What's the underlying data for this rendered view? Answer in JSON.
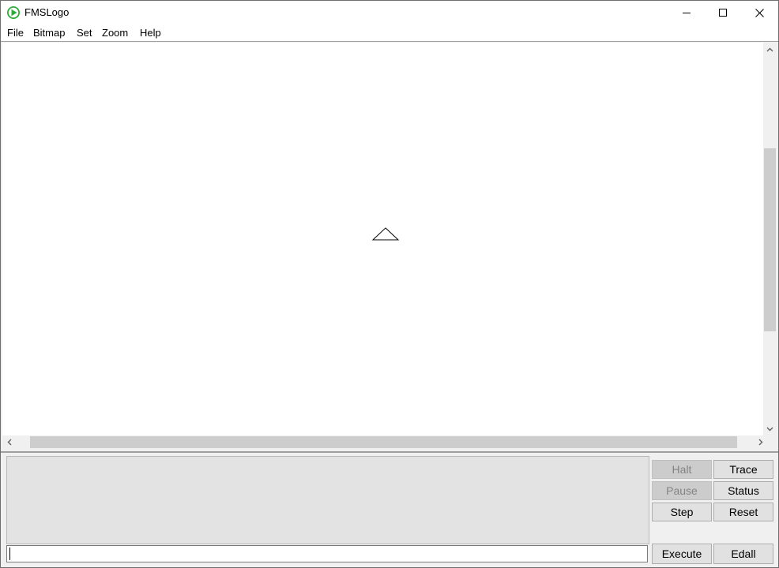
{
  "window": {
    "title": "FMSLogo",
    "controls": {
      "minimize_icon": "minimize-icon",
      "maximize_icon": "maximize-icon",
      "close_icon": "close-icon"
    }
  },
  "menubar": {
    "items": [
      {
        "label": "File"
      },
      {
        "label": "Bitmap"
      },
      {
        "label": "Set"
      },
      {
        "label": "Zoom"
      },
      {
        "label": "Help"
      }
    ]
  },
  "canvas": {
    "background": "#ffffff",
    "turtle_icon": "triangle-turtle-icon"
  },
  "commander": {
    "history_text": "",
    "input_value": "",
    "buttons": {
      "halt": {
        "label": "Halt",
        "enabled": false
      },
      "trace": {
        "label": "Trace",
        "enabled": true
      },
      "pause": {
        "label": "Pause",
        "enabled": false
      },
      "status": {
        "label": "Status",
        "enabled": true
      },
      "step": {
        "label": "Step",
        "enabled": true
      },
      "reset": {
        "label": "Reset",
        "enabled": true
      },
      "execute": {
        "label": "Execute",
        "enabled": true
      },
      "edall": {
        "label": "Edall",
        "enabled": true
      }
    }
  },
  "colors": {
    "app_icon": "#2eaa3a",
    "disabled_button": "#cccccc",
    "history_background": "#e3e3e3"
  }
}
